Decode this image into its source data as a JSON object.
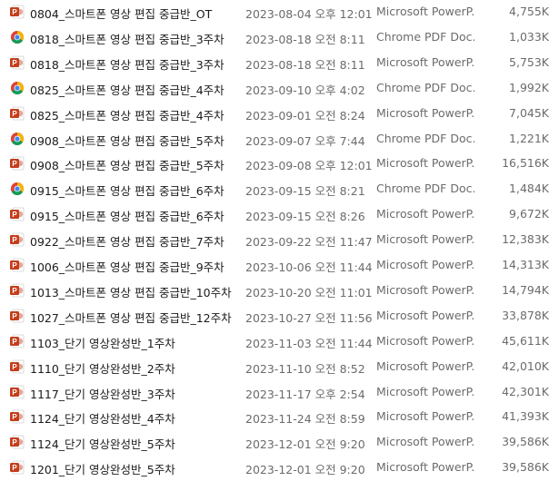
{
  "files": [
    {
      "name": "0804_스마트폰 영상 편집 중급반_OT",
      "date": "2023-08-04 오후 12:01",
      "type": "Microsoft PowerP...",
      "size": "4,755K",
      "icon": "powerpoint-icon"
    },
    {
      "name": "0818_스마트폰 영상 편집 중급반_3주차",
      "date": "2023-08-18 오전 8:11",
      "type": "Chrome PDF Doc...",
      "size": "1,033K",
      "icon": "chrome-pdf-icon"
    },
    {
      "name": "0818_스마트폰 영상 편집 중급반_3주차",
      "date": "2023-08-18 오전 8:11",
      "type": "Microsoft PowerP...",
      "size": "5,753K",
      "icon": "powerpoint-icon"
    },
    {
      "name": "0825_스마트폰 영상 편집 중급반_4주차",
      "date": "2023-09-10 오후 4:02",
      "type": "Chrome PDF Doc...",
      "size": "1,992K",
      "icon": "chrome-pdf-icon"
    },
    {
      "name": "0825_스마트폰 영상 편집 중급반_4주차",
      "date": "2023-09-01 오전 8:24",
      "type": "Microsoft PowerP...",
      "size": "7,045K",
      "icon": "powerpoint-icon"
    },
    {
      "name": "0908_스마트폰 영상 편집 중급반_5주차",
      "date": "2023-09-07 오후 7:44",
      "type": "Chrome PDF Doc...",
      "size": "1,221K",
      "icon": "chrome-pdf-icon"
    },
    {
      "name": "0908_스마트폰 영상 편집 중급반_5주차",
      "date": "2023-09-08 오후 12:01",
      "type": "Microsoft PowerP...",
      "size": "16,516K",
      "icon": "powerpoint-icon"
    },
    {
      "name": "0915_스마트폰 영상 편집 중급반_6주차",
      "date": "2023-09-15 오전 8:21",
      "type": "Chrome PDF Doc...",
      "size": "1,484K",
      "icon": "chrome-pdf-icon"
    },
    {
      "name": "0915_스마트폰 영상 편집 중급반_6주차",
      "date": "2023-09-15 오전 8:26",
      "type": "Microsoft PowerP...",
      "size": "9,672K",
      "icon": "powerpoint-icon"
    },
    {
      "name": "0922_스마트폰 영상 편집 중급반_7주차",
      "date": "2023-09-22 오전 11:47",
      "type": "Microsoft PowerP...",
      "size": "12,383K",
      "icon": "powerpoint-icon"
    },
    {
      "name": "1006_스마트폰 영상 편집 중급반_9주차",
      "date": "2023-10-06 오전 11:44",
      "type": "Microsoft PowerP...",
      "size": "14,313K",
      "icon": "powerpoint-icon"
    },
    {
      "name": "1013_스마트폰 영상 편집 중급반_10주차",
      "date": "2023-10-20 오전 11:01",
      "type": "Microsoft PowerP...",
      "size": "14,794K",
      "icon": "powerpoint-icon"
    },
    {
      "name": "1027_스마트폰 영상 편집 중급반_12주차",
      "date": "2023-10-27 오전 11:56",
      "type": "Microsoft PowerP...",
      "size": "33,878K",
      "icon": "powerpoint-icon"
    },
    {
      "name": "1103_단기 영상완성반_1주차",
      "date": "2023-11-03 오전 11:44",
      "type": "Microsoft PowerP...",
      "size": "45,611K",
      "icon": "powerpoint-icon"
    },
    {
      "name": "1110_단기 영상완성반_2주차",
      "date": "2023-11-10 오전 8:52",
      "type": "Microsoft PowerP...",
      "size": "42,010K",
      "icon": "powerpoint-icon"
    },
    {
      "name": "1117_단기 영상완성반_3주차",
      "date": "2023-11-17 오후 2:54",
      "type": "Microsoft PowerP...",
      "size": "42,301K",
      "icon": "powerpoint-icon"
    },
    {
      "name": "1124_단기 영상완성반_4주차",
      "date": "2023-11-24 오전 8:59",
      "type": "Microsoft PowerP...",
      "size": "41,393K",
      "icon": "powerpoint-icon"
    },
    {
      "name": "1124_단기 영상완성반_5주차",
      "date": "2023-12-01 오전 9:20",
      "type": "Microsoft PowerP...",
      "size": "39,586K",
      "icon": "powerpoint-icon"
    },
    {
      "name": "1201_단기 영상완성반_5주차",
      "date": "2023-12-01 오전 9:20",
      "type": "Microsoft PowerP...",
      "size": "39,586K",
      "icon": "powerpoint-icon"
    }
  ],
  "colors": {
    "powerpoint": "#c43e1c",
    "chrome_red": "#db4437",
    "chrome_yellow": "#f4b400",
    "chrome_green": "#0f9d58",
    "chrome_blue": "#4285f4"
  }
}
